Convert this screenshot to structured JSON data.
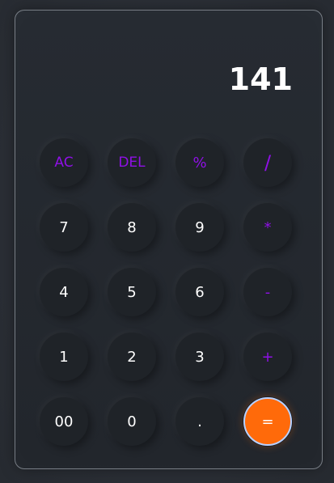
{
  "display": {
    "value": "141"
  },
  "keys": {
    "ac": "AC",
    "del": "DEL",
    "percent": "%",
    "divide": "/",
    "seven": "7",
    "eight": "8",
    "nine": "9",
    "multiply": "*",
    "four": "4",
    "five": "5",
    "six": "6",
    "minus": "-",
    "one": "1",
    "two": "2",
    "three": "3",
    "plus": "+",
    "double_zero": "00",
    "zero": "0",
    "dot": ".",
    "equals": "="
  },
  "colors": {
    "operator": "#8f10e6",
    "equals_bg": "#ff6a0a",
    "key_bg": "#1f2328",
    "panel_bg": "#23272d"
  }
}
